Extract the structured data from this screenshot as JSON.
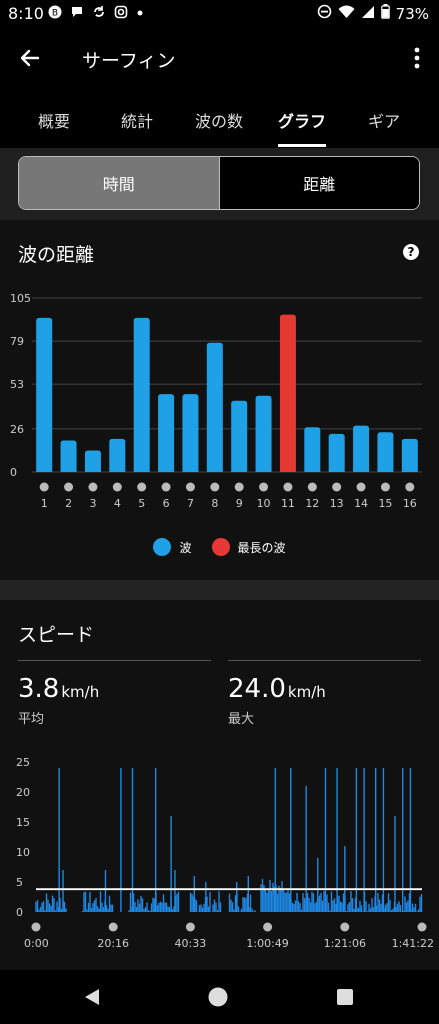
{
  "status": {
    "time": "8:10",
    "battery": "73%",
    "left_icons": [
      "message-badge-icon",
      "speech-bubble-icon",
      "sync-icon",
      "instagram-icon",
      "dot-icon"
    ],
    "right_icons": [
      "do-not-disturb-icon",
      "wifi-icon",
      "signal-icon",
      "battery-icon"
    ]
  },
  "appbar": {
    "title": "サーフィン"
  },
  "tabs": [
    {
      "label": "概要"
    },
    {
      "label": "統計"
    },
    {
      "label": "波の数"
    },
    {
      "label": "グラフ",
      "active": true
    },
    {
      "label": "ギア"
    }
  ],
  "segment": {
    "left": "時間",
    "right": "距離",
    "active": "left"
  },
  "waves_card": {
    "title": "波の距離",
    "help": "?",
    "legend": [
      {
        "label": "波",
        "color": "#1ea1e6"
      },
      {
        "label": "最長の波",
        "color": "#e53935"
      }
    ]
  },
  "speed_card": {
    "title": "スピード",
    "avg_value": "3.8",
    "avg_unit": "km/h",
    "avg_label": "平均",
    "max_value": "24.0",
    "max_unit": "km/h",
    "max_label": "最大"
  },
  "chart_data": [
    {
      "type": "bar",
      "title": "波の距離",
      "categories": [
        "1",
        "2",
        "3",
        "4",
        "5",
        "6",
        "7",
        "8",
        "9",
        "10",
        "11",
        "12",
        "13",
        "14",
        "15",
        "16"
      ],
      "values": [
        93,
        19,
        13,
        20,
        93,
        47,
        47,
        78,
        43,
        46,
        95,
        27,
        23,
        28,
        24,
        20
      ],
      "highlight_index": 10,
      "yticks": [
        "105",
        "79",
        "53",
        "26",
        "0"
      ],
      "ylim": [
        0,
        105
      ],
      "colors": {
        "bar": "#1ea1e6",
        "highlight": "#e53935"
      }
    },
    {
      "type": "area",
      "title": "スピード",
      "yticks": [
        "25",
        "20",
        "15",
        "10",
        "5",
        "0"
      ],
      "ylim": [
        0,
        25
      ],
      "xticks": [
        "0:00",
        "20:16",
        "40:33",
        "1:00:49",
        "1:21:06",
        "1:41:22"
      ],
      "average_line": 3.8,
      "color": "#1e88e5",
      "spikes": [
        {
          "t": 0.06,
          "v": 24
        },
        {
          "t": 0.07,
          "v": 7
        },
        {
          "t": 0.18,
          "v": 7
        },
        {
          "t": 0.22,
          "v": 24
        },
        {
          "t": 0.25,
          "v": 24
        },
        {
          "t": 0.31,
          "v": 24
        },
        {
          "t": 0.35,
          "v": 16
        },
        {
          "t": 0.36,
          "v": 7
        },
        {
          "t": 0.41,
          "v": 6
        },
        {
          "t": 0.44,
          "v": 5
        },
        {
          "t": 0.52,
          "v": 5
        },
        {
          "t": 0.55,
          "v": 6
        },
        {
          "t": 0.62,
          "v": 24
        },
        {
          "t": 0.66,
          "v": 24
        },
        {
          "t": 0.7,
          "v": 21
        },
        {
          "t": 0.73,
          "v": 9
        },
        {
          "t": 0.75,
          "v": 24
        },
        {
          "t": 0.78,
          "v": 24
        },
        {
          "t": 0.8,
          "v": 11
        },
        {
          "t": 0.83,
          "v": 24
        },
        {
          "t": 0.85,
          "v": 24
        },
        {
          "t": 0.88,
          "v": 24
        },
        {
          "t": 0.9,
          "v": 24
        },
        {
          "t": 0.93,
          "v": 16
        },
        {
          "t": 0.95,
          "v": 24
        },
        {
          "t": 0.97,
          "v": 24
        }
      ]
    }
  ]
}
